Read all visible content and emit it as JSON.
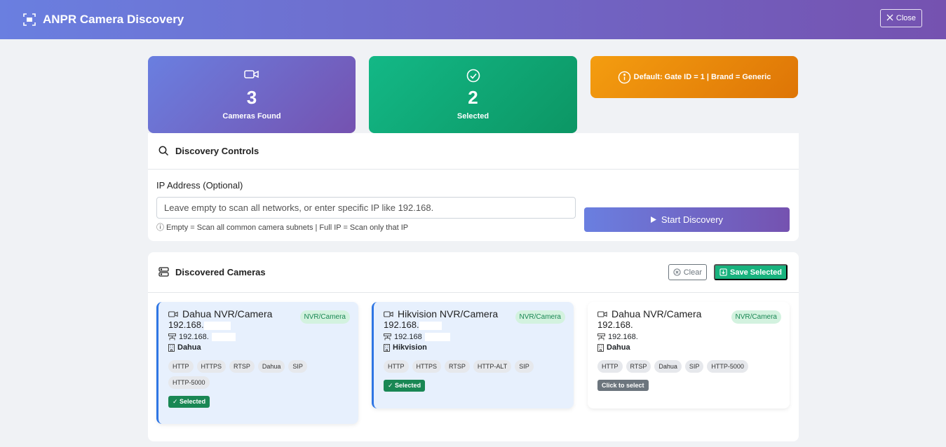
{
  "header": {
    "title": "ANPR Camera Discovery",
    "close_label": "Close"
  },
  "stats": {
    "found_count": "3",
    "found_label": "Cameras Found",
    "selected_count": "2",
    "selected_label": "Selected",
    "default_info": "Default: Gate ID = 1 | Brand = Generic"
  },
  "controls": {
    "title": "Discovery Controls",
    "ip_label": "IP Address (Optional)",
    "ip_placeholder": "Leave empty to scan all networks, or enter specific IP like 192.168.",
    "ip_value": "",
    "hint": "ⓘ Empty = Scan all common camera subnets | Full IP = Scan only that IP",
    "start_label": "Start Discovery"
  },
  "discovered": {
    "title": "Discovered Cameras",
    "clear_label": "Clear",
    "save_label": "Save Selected",
    "cameras": [
      {
        "name": "Dahua NVR/Camera",
        "ip_title": "192.168.",
        "type_badge": "NVR/Camera",
        "ip": "192.168.",
        "brand": "Dahua",
        "tags": [
          "HTTP",
          "HTTPS",
          "RTSP",
          "Dahua",
          "SIP",
          "HTTP-5000"
        ],
        "status": "✓ Selected"
      },
      {
        "name": "Hikvision NVR/Camera",
        "ip_title": "192.168.",
        "type_badge": "NVR/Camera",
        "ip": "192.168",
        "brand": "Hikvision",
        "tags": [
          "HTTP",
          "HTTPS",
          "RTSP",
          "HTTP-ALT",
          "SIP"
        ],
        "status": "✓ Selected"
      },
      {
        "name": "Dahua NVR/Camera",
        "ip_title": "192.168.",
        "type_badge": "NVR/Camera",
        "ip": "192.168.",
        "brand": "Dahua",
        "tags": [
          "HTTP",
          "RTSP",
          "Dahua",
          "SIP",
          "HTTP-5000"
        ],
        "status": "Click to select"
      }
    ]
  }
}
